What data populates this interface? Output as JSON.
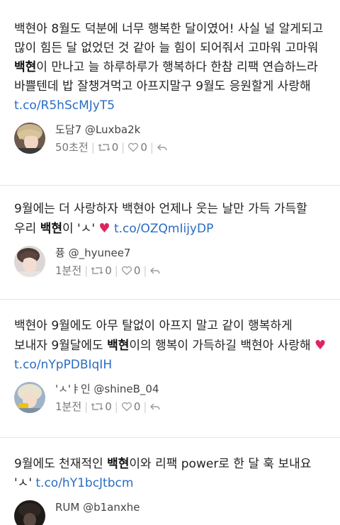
{
  "tweets": [
    {
      "segments": [
        {
          "t": "백현아 8월도 덕분에 너무 행복한 달이였어! 사실 널 알게되고 많이 힘든 달 없었던 것 같아 늘 힘이 되어줘서 고마워 고마워 ",
          "s": "plain"
        },
        {
          "t": "백현",
          "s": "hl"
        },
        {
          "t": "이 만나고 늘 하루하루가 행복하다 한참 리팩 연습하느라 바쁠텐데 밥 잘챙겨먹고 아프지말구 9월도 응원할게 사랑해 ",
          "s": "plain"
        },
        {
          "t": "t.co/R5hScMJyT5",
          "s": "link"
        }
      ],
      "author": "도담7 @Luxba2k",
      "time": "50초전",
      "retweets": "0",
      "likes": "0"
    },
    {
      "segments": [
        {
          "t": "9월에는 더 사랑하자 백현아 언제나 웃는 날만 가득 가득할 우리 ",
          "s": "plain"
        },
        {
          "t": "백현",
          "s": "hl"
        },
        {
          "t": "이 'ㅅ' ",
          "s": "plain"
        },
        {
          "t": "♥",
          "s": "heart"
        },
        {
          "t": " ",
          "s": "plain"
        },
        {
          "t": "t.co/OZQmIijyDP",
          "s": "link"
        }
      ],
      "author": "퓽 @_hyunee7",
      "time": "1분전",
      "retweets": "0",
      "likes": "0"
    },
    {
      "segments": [
        {
          "t": "백현아 9월에도 아무 탈없이 아프지 말고 같이 행복하게 보내자 9월달에도 ",
          "s": "plain"
        },
        {
          "t": "백현",
          "s": "hl"
        },
        {
          "t": "이의 행복이 가득하길 백현아 사랑해 ",
          "s": "plain"
        },
        {
          "t": "♥",
          "s": "heart"
        },
        {
          "t": " ",
          "s": "plain"
        },
        {
          "t": "t.co/nYpPDBIqIH",
          "s": "link"
        }
      ],
      "author": "'ㅅ'ㅑ인 @shineB_04",
      "time": "1분전",
      "retweets": "0",
      "likes": "0"
    },
    {
      "segments": [
        {
          "t": "9월에도 천재적인 ",
          "s": "plain"
        },
        {
          "t": "백현",
          "s": "hl"
        },
        {
          "t": "이와 리팩 power로 한 달 훅 보내요 'ㅅ' ",
          "s": "plain"
        },
        {
          "t": "t.co/hY1bcJtbcm",
          "s": "link"
        }
      ],
      "author": "RUM @b1anxhe",
      "time": "",
      "retweets": "",
      "likes": ""
    }
  ],
  "colors": {
    "link": "#2a6cc4",
    "heart": "#e0245e",
    "meta": "#777777",
    "divider": "#e6e6e6"
  }
}
